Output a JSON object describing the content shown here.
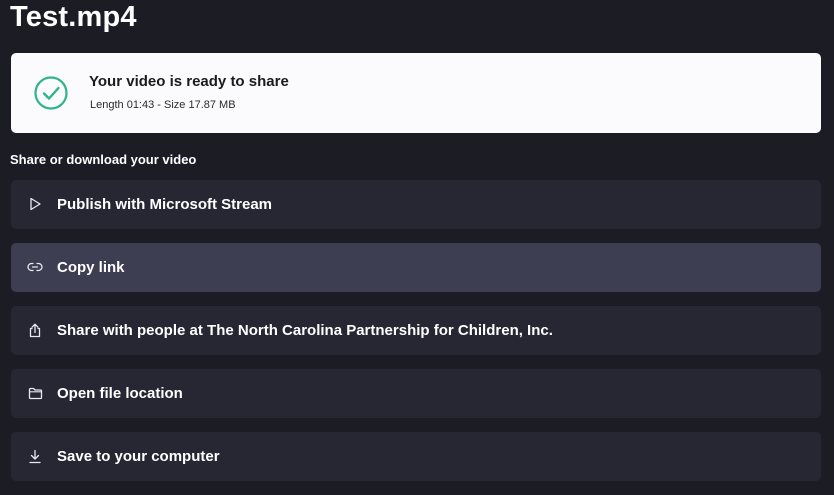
{
  "title": "Test.mp4",
  "status_card": {
    "title": "Your video is ready to share",
    "meta": "Length 01:43 - Size 17.87 MB",
    "icon": "check-circle-icon",
    "accent": "#2fb48a"
  },
  "section_label": "Share or download your video",
  "options": [
    {
      "label": "Publish with Microsoft Stream",
      "icon": "play-icon"
    },
    {
      "label": "Copy link",
      "icon": "link-icon"
    },
    {
      "label": "Share with people at The North Carolina Partnership for Children, Inc.",
      "icon": "share-icon"
    },
    {
      "label": "Open file location",
      "icon": "folder-icon"
    },
    {
      "label": "Save to your computer",
      "icon": "download-icon"
    }
  ],
  "colors": {
    "background": "#1c1c25",
    "option": "#272734",
    "option_hover": "#3e3e52",
    "card": "#fbfbfd"
  }
}
